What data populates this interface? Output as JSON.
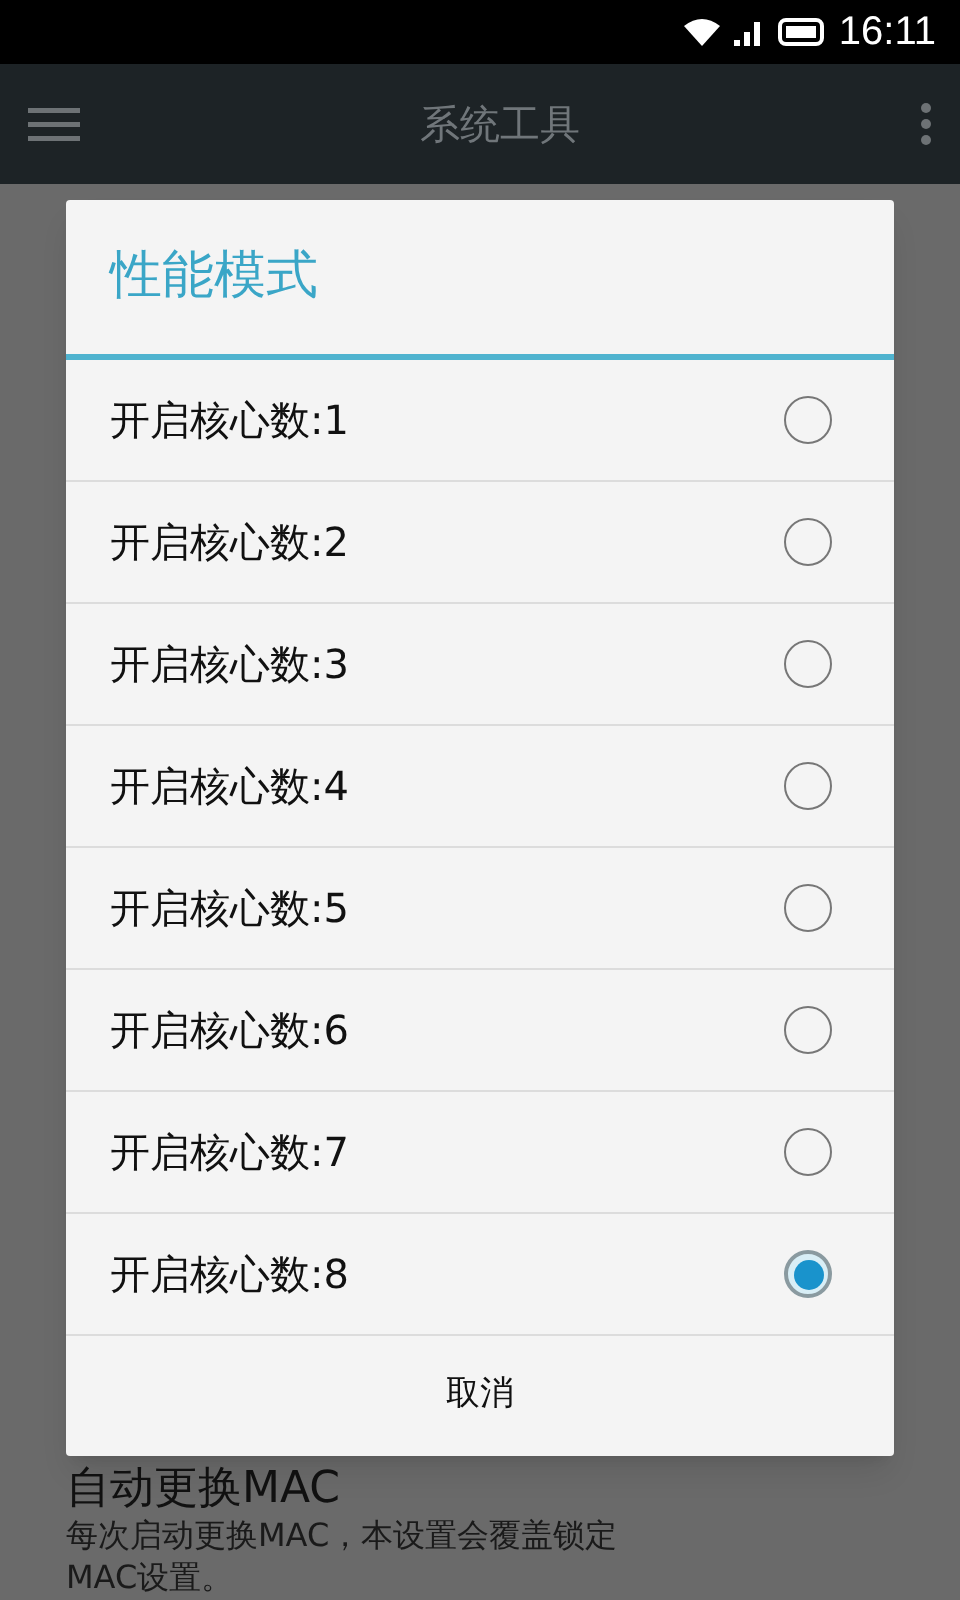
{
  "status_bar": {
    "time": "16:11"
  },
  "app_bar": {
    "title": "系统工具"
  },
  "background_item": {
    "title": "自动更换MAC",
    "description": "每次启动更换MAC，本设置会覆盖锁定MAC设置。"
  },
  "dialog": {
    "title": "性能模式",
    "options": [
      {
        "label": "开启核心数:1",
        "selected": false
      },
      {
        "label": "开启核心数:2",
        "selected": false
      },
      {
        "label": "开启核心数:3",
        "selected": false
      },
      {
        "label": "开启核心数:4",
        "selected": false
      },
      {
        "label": "开启核心数:5",
        "selected": false
      },
      {
        "label": "开启核心数:6",
        "selected": false
      },
      {
        "label": "开启核心数:7",
        "selected": false
      },
      {
        "label": "开启核心数:8",
        "selected": true
      }
    ],
    "cancel": "取消"
  }
}
